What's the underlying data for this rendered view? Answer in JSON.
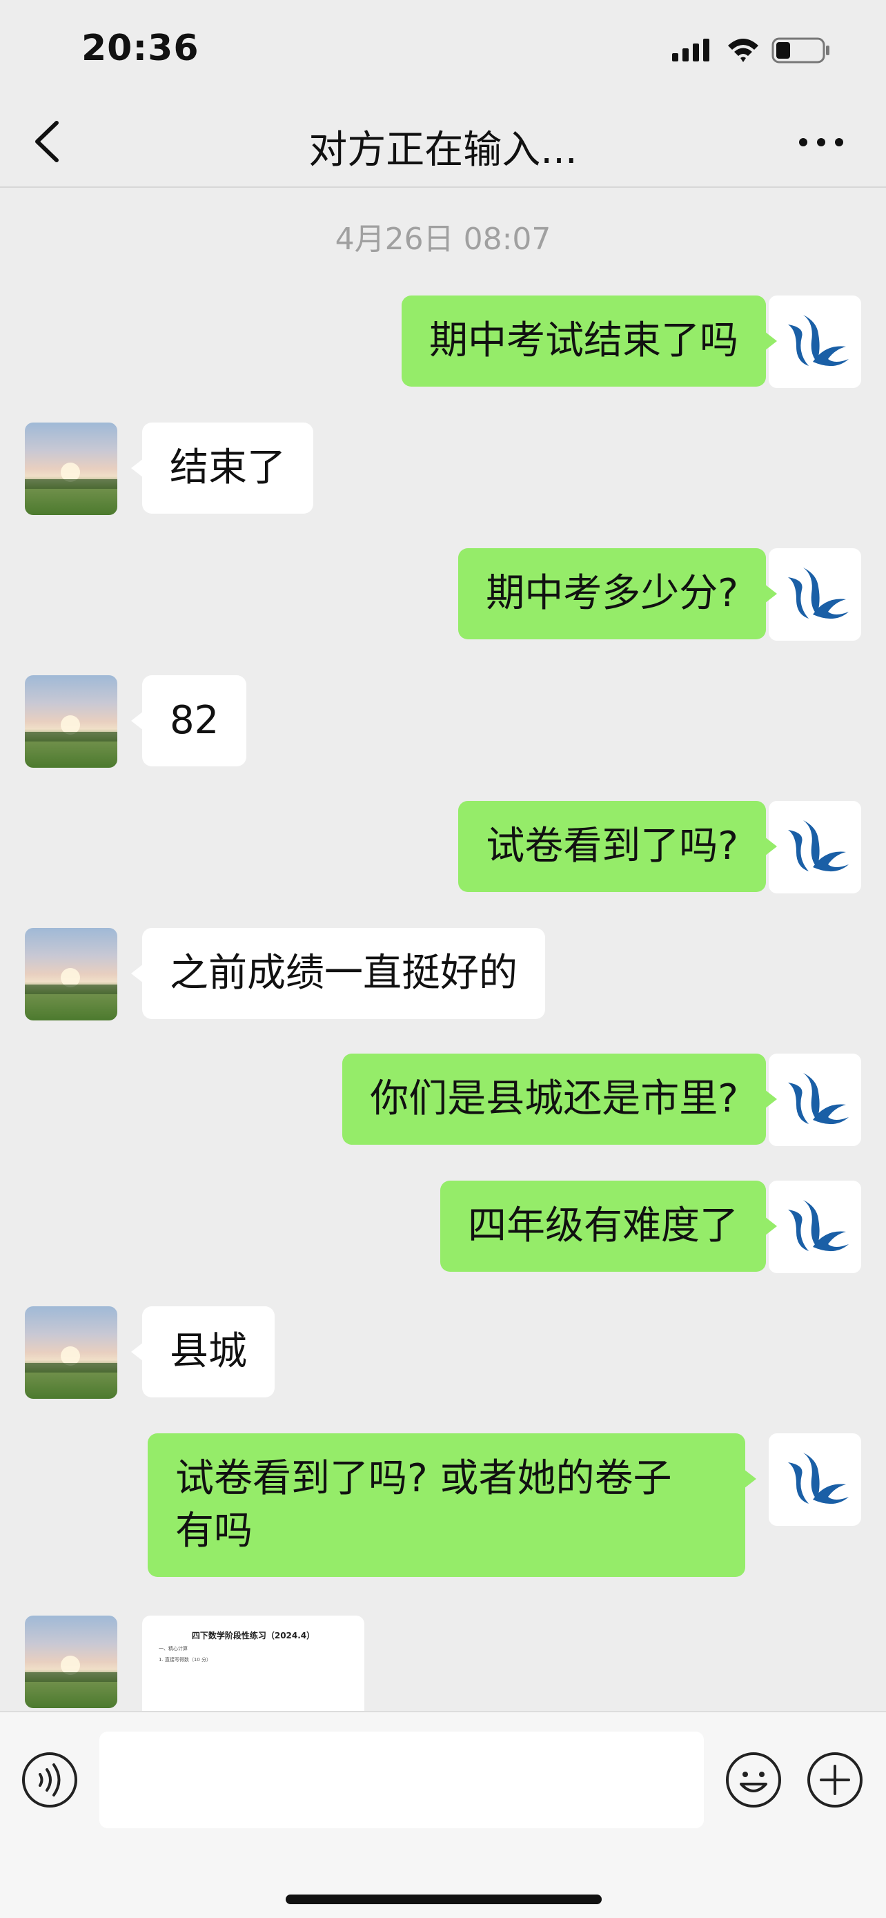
{
  "status_bar": {
    "time": "20:36"
  },
  "nav": {
    "title": "对方正在输入..."
  },
  "chat": {
    "timestamp": "4月26日 08:07",
    "messages": [
      {
        "side": "me",
        "text": "期中考试结束了吗"
      },
      {
        "side": "peer",
        "text": "结束了"
      },
      {
        "side": "me",
        "text": "期中考多少分?"
      },
      {
        "side": "peer",
        "text": "82"
      },
      {
        "side": "me",
        "text": "试卷看到了吗?"
      },
      {
        "side": "peer",
        "text": "之前成绩一直挺好的"
      },
      {
        "side": "me",
        "text": "你们是县城还是市里?"
      },
      {
        "side": "me",
        "text": "四年级有难度了"
      },
      {
        "side": "peer",
        "text": "县城"
      },
      {
        "side": "me",
        "text": "试卷看到了吗? 或者她的卷子\n有吗"
      }
    ],
    "file_preview": {
      "title": "四下数学阶段性练习（2024.4）",
      "line1": "一、精心计算",
      "line2": "1. 直接写得数（10 分）"
    }
  },
  "input_bar": {
    "placeholder": ""
  },
  "colors": {
    "me_bubble": "#95ec69",
    "peer_bubble": "#ffffff",
    "background": "#ededed"
  }
}
